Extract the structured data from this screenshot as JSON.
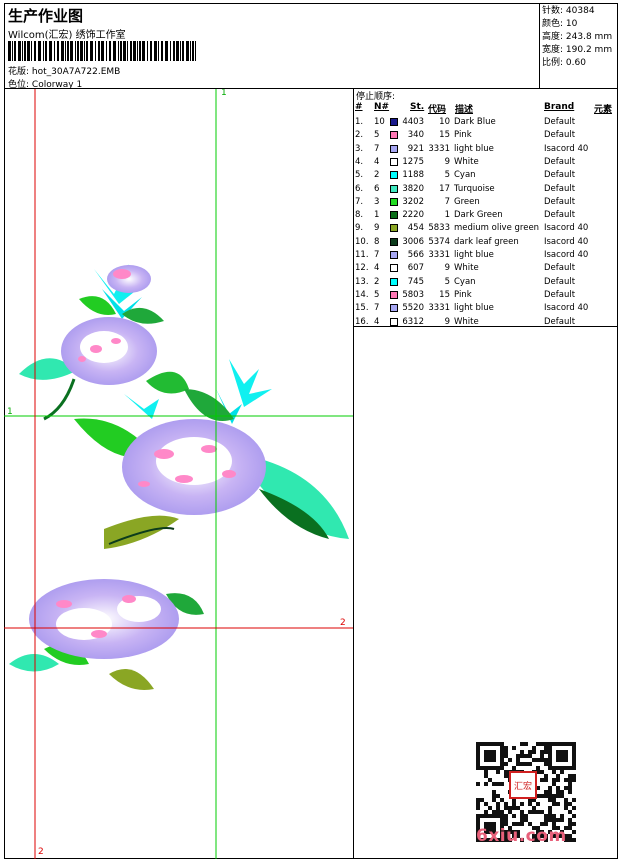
{
  "header": {
    "title": "生产作业图",
    "company": "Wilcom(汇宏) 绣饰工作室",
    "design_file_label": "花版:",
    "design_file": "hot_30A7A722.EMB",
    "colorway_label": "色位:",
    "colorway": "Colorway 1"
  },
  "stats": [
    {
      "label": "针数:",
      "value": "40384"
    },
    {
      "label": "颜色:",
      "value": "10"
    },
    {
      "label": "高度:",
      "value": "243.8 mm"
    },
    {
      "label": "宽度:",
      "value": "190.2 mm"
    },
    {
      "label": "比例:",
      "value": "0.60"
    }
  ],
  "stop_sequence": {
    "title": "停止顺序:",
    "headers": [
      "#",
      "N#",
      "St.",
      "代码",
      "描述",
      "Brand",
      "元素"
    ],
    "rows": [
      {
        "idx": "1.",
        "n": "10",
        "color": "#1a1a8c",
        "st": "4403",
        "code": "10",
        "desc": "Dark Blue",
        "brand": "Default"
      },
      {
        "idx": "2.",
        "n": "5",
        "color": "#ff77b4",
        "st": "340",
        "code": "15",
        "desc": "Pink",
        "brand": "Default"
      },
      {
        "idx": "3.",
        "n": "7",
        "color": "#a6a6f2",
        "st": "921",
        "code": "3331",
        "desc": "light blue",
        "brand": "Isacord 40"
      },
      {
        "idx": "4.",
        "n": "4",
        "color": "#ffffff",
        "st": "1275",
        "code": "9",
        "desc": "White",
        "brand": "Default"
      },
      {
        "idx": "5.",
        "n": "2",
        "color": "#00ffff",
        "st": "1188",
        "code": "5",
        "desc": "Cyan",
        "brand": "Default"
      },
      {
        "idx": "6.",
        "n": "6",
        "color": "#40e8c0",
        "st": "3820",
        "code": "17",
        "desc": "Turquoise",
        "brand": "Default"
      },
      {
        "idx": "7.",
        "n": "3",
        "color": "#22dd22",
        "st": "3202",
        "code": "7",
        "desc": "Green",
        "brand": "Default"
      },
      {
        "idx": "8.",
        "n": "1",
        "color": "#0a6e18",
        "st": "2220",
        "code": "1",
        "desc": "Dark Green",
        "brand": "Default"
      },
      {
        "idx": "9.",
        "n": "9",
        "color": "#8aa624",
        "st": "454",
        "code": "5833",
        "desc": "medium olive green",
        "brand": "Isacord 40"
      },
      {
        "idx": "10.",
        "n": "8",
        "color": "#0c3c1c",
        "st": "3006",
        "code": "5374",
        "desc": "dark leaf green",
        "brand": "Isacord 40"
      },
      {
        "idx": "11.",
        "n": "7",
        "color": "#a6a6f2",
        "st": "566",
        "code": "3331",
        "desc": "light blue",
        "brand": "Isacord 40"
      },
      {
        "idx": "12.",
        "n": "4",
        "color": "#ffffff",
        "st": "607",
        "code": "9",
        "desc": "White",
        "brand": "Default"
      },
      {
        "idx": "13.",
        "n": "2",
        "color": "#00ffff",
        "st": "745",
        "code": "5",
        "desc": "Cyan",
        "brand": "Default"
      },
      {
        "idx": "14.",
        "n": "5",
        "color": "#ff77b4",
        "st": "5803",
        "code": "15",
        "desc": "Pink",
        "brand": "Default"
      },
      {
        "idx": "15.",
        "n": "7",
        "color": "#a6a6f2",
        "st": "5520",
        "code": "3331",
        "desc": "light blue",
        "brand": "Isacord 40"
      },
      {
        "idx": "16.",
        "n": "4",
        "color": "#ffffff",
        "st": "6312",
        "code": "9",
        "desc": "White",
        "brand": "Default"
      }
    ]
  },
  "guides": {
    "green_label_top": "1",
    "green_label_left": "1",
    "red_label_right": "2",
    "red_label_bottom": "2"
  },
  "watermark": {
    "text": "6xiu.com",
    "seal": "汇宏"
  },
  "colors": {
    "guide_green": "#00cc00",
    "guide_red": "#dd0000"
  }
}
